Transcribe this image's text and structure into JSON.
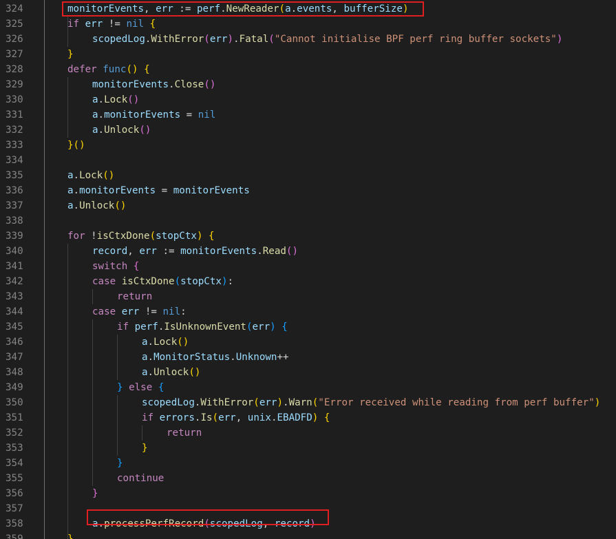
{
  "editor": {
    "lines": [
      {
        "n": "324",
        "indent": 0,
        "tokens": [
          [
            "cv",
            "monitorEvents"
          ],
          [
            "cp",
            ", "
          ],
          [
            "cv",
            "err"
          ],
          [
            "cp",
            " := "
          ],
          [
            "cv",
            "perf"
          ],
          [
            "cp",
            "."
          ],
          [
            "cf",
            "NewReader"
          ],
          [
            "b1",
            "("
          ],
          [
            "cv",
            "a"
          ],
          [
            "cp",
            "."
          ],
          [
            "cv",
            "events"
          ],
          [
            "cp",
            ", "
          ],
          [
            "cv",
            "bufferSize"
          ],
          [
            "b1",
            ")"
          ]
        ]
      },
      {
        "n": "325",
        "indent": 0,
        "tokens": [
          [
            "ck",
            "if"
          ],
          [
            "cp",
            " "
          ],
          [
            "cv",
            "err"
          ],
          [
            "cp",
            " != "
          ],
          [
            "cb",
            "nil"
          ],
          [
            "cp",
            " "
          ],
          [
            "b1",
            "{"
          ]
        ]
      },
      {
        "n": "326",
        "indent": 1,
        "tokens": [
          [
            "cv",
            "scopedLog"
          ],
          [
            "cp",
            "."
          ],
          [
            "cf",
            "WithError"
          ],
          [
            "b2",
            "("
          ],
          [
            "cv",
            "err"
          ],
          [
            "b2",
            ")"
          ],
          [
            "cp",
            "."
          ],
          [
            "cf",
            "Fatal"
          ],
          [
            "b2",
            "("
          ],
          [
            "cs",
            "\"Cannot initialise BPF perf ring buffer sockets\""
          ],
          [
            "b2",
            ")"
          ]
        ]
      },
      {
        "n": "327",
        "indent": 0,
        "tokens": [
          [
            "b1",
            "}"
          ]
        ]
      },
      {
        "n": "328",
        "indent": 0,
        "tokens": [
          [
            "ck",
            "defer"
          ],
          [
            "cp",
            " "
          ],
          [
            "cb",
            "func"
          ],
          [
            "b1",
            "()"
          ],
          [
            "cp",
            " "
          ],
          [
            "b1",
            "{"
          ]
        ]
      },
      {
        "n": "329",
        "indent": 1,
        "tokens": [
          [
            "cv",
            "monitorEvents"
          ],
          [
            "cp",
            "."
          ],
          [
            "cf",
            "Close"
          ],
          [
            "b2",
            "()"
          ]
        ]
      },
      {
        "n": "330",
        "indent": 1,
        "tokens": [
          [
            "cv",
            "a"
          ],
          [
            "cp",
            "."
          ],
          [
            "cf",
            "Lock"
          ],
          [
            "b2",
            "()"
          ]
        ]
      },
      {
        "n": "331",
        "indent": 1,
        "tokens": [
          [
            "cv",
            "a"
          ],
          [
            "cp",
            "."
          ],
          [
            "cv",
            "monitorEvents"
          ],
          [
            "cp",
            " = "
          ],
          [
            "cb",
            "nil"
          ]
        ]
      },
      {
        "n": "332",
        "indent": 1,
        "tokens": [
          [
            "cv",
            "a"
          ],
          [
            "cp",
            "."
          ],
          [
            "cf",
            "Unlock"
          ],
          [
            "b2",
            "()"
          ]
        ]
      },
      {
        "n": "333",
        "indent": 0,
        "tokens": [
          [
            "b1",
            "}()"
          ]
        ]
      },
      {
        "n": "334",
        "indent": 0,
        "tokens": []
      },
      {
        "n": "335",
        "indent": 0,
        "tokens": [
          [
            "cv",
            "a"
          ],
          [
            "cp",
            "."
          ],
          [
            "cf",
            "Lock"
          ],
          [
            "b1",
            "()"
          ]
        ]
      },
      {
        "n": "336",
        "indent": 0,
        "tokens": [
          [
            "cv",
            "a"
          ],
          [
            "cp",
            "."
          ],
          [
            "cv",
            "monitorEvents"
          ],
          [
            "cp",
            " = "
          ],
          [
            "cv",
            "monitorEvents"
          ]
        ]
      },
      {
        "n": "337",
        "indent": 0,
        "tokens": [
          [
            "cv",
            "a"
          ],
          [
            "cp",
            "."
          ],
          [
            "cf",
            "Unlock"
          ],
          [
            "b1",
            "()"
          ]
        ]
      },
      {
        "n": "338",
        "indent": 0,
        "tokens": []
      },
      {
        "n": "339",
        "indent": 0,
        "tokens": [
          [
            "ck",
            "for"
          ],
          [
            "cp",
            " !"
          ],
          [
            "cf",
            "isCtxDone"
          ],
          [
            "b1",
            "("
          ],
          [
            "cv",
            "stopCtx"
          ],
          [
            "b1",
            ")"
          ],
          [
            "cp",
            " "
          ],
          [
            "b1",
            "{"
          ]
        ]
      },
      {
        "n": "340",
        "indent": 1,
        "tokens": [
          [
            "cv",
            "record"
          ],
          [
            "cp",
            ", "
          ],
          [
            "cv",
            "err"
          ],
          [
            "cp",
            " := "
          ],
          [
            "cv",
            "monitorEvents"
          ],
          [
            "cp",
            "."
          ],
          [
            "cf",
            "Read"
          ],
          [
            "b2",
            "()"
          ]
        ]
      },
      {
        "n": "341",
        "indent": 1,
        "tokens": [
          [
            "ck",
            "switch"
          ],
          [
            "cp",
            " "
          ],
          [
            "b2",
            "{"
          ]
        ]
      },
      {
        "n": "342",
        "indent": 1,
        "tokens": [
          [
            "ck",
            "case"
          ],
          [
            "cp",
            " "
          ],
          [
            "cf",
            "isCtxDone"
          ],
          [
            "b3",
            "("
          ],
          [
            "cv",
            "stopCtx"
          ],
          [
            "b3",
            ")"
          ],
          [
            "cp",
            ":"
          ]
        ]
      },
      {
        "n": "343",
        "indent": 2,
        "tokens": [
          [
            "ck",
            "return"
          ]
        ]
      },
      {
        "n": "344",
        "indent": 1,
        "tokens": [
          [
            "ck",
            "case"
          ],
          [
            "cp",
            " "
          ],
          [
            "cv",
            "err"
          ],
          [
            "cp",
            " != "
          ],
          [
            "cb",
            "nil"
          ],
          [
            "cp",
            ":"
          ]
        ]
      },
      {
        "n": "345",
        "indent": 2,
        "tokens": [
          [
            "ck",
            "if"
          ],
          [
            "cp",
            " "
          ],
          [
            "cv",
            "perf"
          ],
          [
            "cp",
            "."
          ],
          [
            "cf",
            "IsUnknownEvent"
          ],
          [
            "b3",
            "("
          ],
          [
            "cv",
            "err"
          ],
          [
            "b3",
            ")"
          ],
          [
            "cp",
            " "
          ],
          [
            "b3",
            "{"
          ]
        ]
      },
      {
        "n": "346",
        "indent": 3,
        "tokens": [
          [
            "cv",
            "a"
          ],
          [
            "cp",
            "."
          ],
          [
            "cf",
            "Lock"
          ],
          [
            "b1",
            "()"
          ]
        ]
      },
      {
        "n": "347",
        "indent": 3,
        "tokens": [
          [
            "cv",
            "a"
          ],
          [
            "cp",
            "."
          ],
          [
            "cv",
            "MonitorStatus"
          ],
          [
            "cp",
            "."
          ],
          [
            "cv",
            "Unknown"
          ],
          [
            "cp",
            "++"
          ]
        ]
      },
      {
        "n": "348",
        "indent": 3,
        "tokens": [
          [
            "cv",
            "a"
          ],
          [
            "cp",
            "."
          ],
          [
            "cf",
            "Unlock"
          ],
          [
            "b1",
            "()"
          ]
        ]
      },
      {
        "n": "349",
        "indent": 2,
        "tokens": [
          [
            "b3",
            "}"
          ],
          [
            "cp",
            " "
          ],
          [
            "ck",
            "else"
          ],
          [
            "cp",
            " "
          ],
          [
            "b3",
            "{"
          ]
        ]
      },
      {
        "n": "350",
        "indent": 3,
        "tokens": [
          [
            "cv",
            "scopedLog"
          ],
          [
            "cp",
            "."
          ],
          [
            "cf",
            "WithError"
          ],
          [
            "b1",
            "("
          ],
          [
            "cv",
            "err"
          ],
          [
            "b1",
            ")"
          ],
          [
            "cp",
            "."
          ],
          [
            "cf",
            "Warn"
          ],
          [
            "b1",
            "("
          ],
          [
            "cs",
            "\"Error received while reading from perf buffer\""
          ],
          [
            "b1",
            ")"
          ]
        ]
      },
      {
        "n": "351",
        "indent": 3,
        "tokens": [
          [
            "ck",
            "if"
          ],
          [
            "cp",
            " "
          ],
          [
            "cv",
            "errors"
          ],
          [
            "cp",
            "."
          ],
          [
            "cf",
            "Is"
          ],
          [
            "b1",
            "("
          ],
          [
            "cv",
            "err"
          ],
          [
            "cp",
            ", "
          ],
          [
            "cv",
            "unix"
          ],
          [
            "cp",
            "."
          ],
          [
            "cv",
            "EBADFD"
          ],
          [
            "b1",
            ")"
          ],
          [
            "cp",
            " "
          ],
          [
            "b1",
            "{"
          ]
        ]
      },
      {
        "n": "352",
        "indent": 4,
        "tokens": [
          [
            "ck",
            "return"
          ]
        ]
      },
      {
        "n": "353",
        "indent": 3,
        "tokens": [
          [
            "b1",
            "}"
          ]
        ]
      },
      {
        "n": "354",
        "indent": 2,
        "tokens": [
          [
            "b3",
            "}"
          ]
        ]
      },
      {
        "n": "355",
        "indent": 2,
        "tokens": [
          [
            "ck",
            "continue"
          ]
        ]
      },
      {
        "n": "356",
        "indent": 1,
        "tokens": [
          [
            "b2",
            "}"
          ]
        ]
      },
      {
        "n": "357",
        "indent": 0,
        "tokens": []
      },
      {
        "n": "358",
        "indent": 1,
        "tokens": [
          [
            "cv",
            "a"
          ],
          [
            "cp",
            "."
          ],
          [
            "cf",
            "processPerfRecord"
          ],
          [
            "b2",
            "("
          ],
          [
            "cv",
            "scopedLog"
          ],
          [
            "cp",
            ", "
          ],
          [
            "cv",
            "record"
          ],
          [
            "b2",
            ")"
          ]
        ]
      },
      {
        "n": "359",
        "indent": 0,
        "tokens": [
          [
            "b1",
            "}"
          ]
        ]
      }
    ],
    "highlights": [
      {
        "line": "324",
        "text": "monitorEvents, err := perf.NewReader(a.events, bufferSize)",
        "color": "#e02020"
      },
      {
        "line": "358",
        "text": "a.processPerfRecord(scopedLog, record)",
        "color": "#e02020"
      }
    ]
  }
}
